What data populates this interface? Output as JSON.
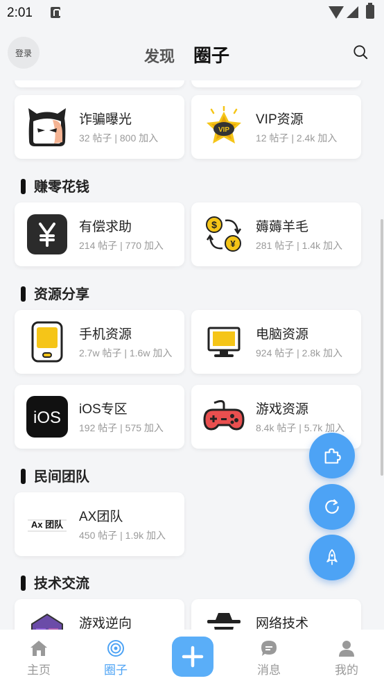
{
  "status_bar": {
    "time": "2:01"
  },
  "header": {
    "login_label": "登录",
    "tab_discover": "发现",
    "tab_circle": "圈子"
  },
  "sections": [
    {
      "title": "赚零花钱"
    },
    {
      "title": "资源分享"
    },
    {
      "title": "民间团队"
    },
    {
      "title": "技术交流"
    }
  ],
  "cards": [
    {
      "title": "诈骗曝光",
      "meta": "32 帖子 | 800 加入",
      "icon": "ghost-mask-icon"
    },
    {
      "title": "VIP资源",
      "meta": "12 帖子 | 2.4k 加入",
      "icon": "vip-star-icon"
    },
    {
      "title": "有偿求助",
      "meta": "214 帖子 | 770 加入",
      "icon": "yen-icon"
    },
    {
      "title": "薅薅羊毛",
      "meta": "281 帖子 | 1.4k 加入",
      "icon": "currency-exchange-icon"
    },
    {
      "title": "手机资源",
      "meta": "2.7w 帖子 | 1.6w 加入",
      "icon": "phone-icon"
    },
    {
      "title": "电脑资源",
      "meta": "924 帖子 | 2.8k 加入",
      "icon": "monitor-icon"
    },
    {
      "title": "iOS专区",
      "meta": "192 帖子 | 575 加入",
      "icon": "ios-icon"
    },
    {
      "title": "游戏资源",
      "meta": "8.4k 帖子 | 5.7k 加入",
      "icon": "gamepad-icon"
    },
    {
      "title": "AX团队",
      "meta": "450 帖子 | 1.9k 加入",
      "icon": "ax-team-logo-icon",
      "logo_text": "Ax 团队"
    },
    {
      "title": "游戏逆向",
      "meta": "",
      "icon": "game-reverse-icon"
    },
    {
      "title": "网络技术",
      "meta": "",
      "icon": "hacker-icon"
    }
  ],
  "ios_icon_text": "iOS",
  "tabbar": {
    "home": "主页",
    "circle": "圈子",
    "messages": "消息",
    "mine": "我的"
  },
  "colors": {
    "accent": "#4da3f5",
    "background": "#f4f5f7"
  }
}
